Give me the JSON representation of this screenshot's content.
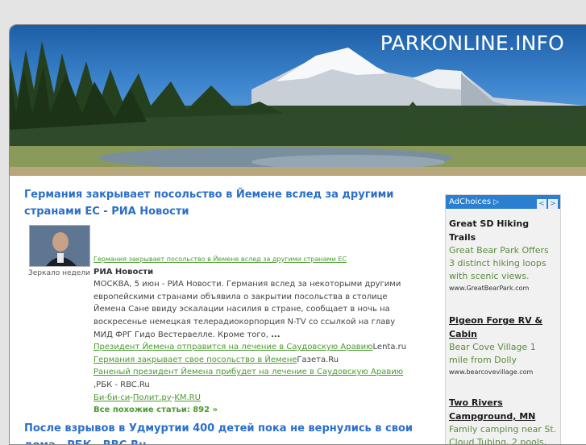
{
  "site": {
    "title": "PARKONLINE.INFO"
  },
  "articles": [
    {
      "title": "Германия закрывает посольство в Йемене вслед за другими странами ЕС - РИА Новости",
      "thumb_caption": "Зеркало недели",
      "headline_link": "Германия закрывает посольство в Йемене вслед за другими странами ЕС",
      "source": "РИА Новости",
      "body": "МОСКВА, 5 июн - РИА Новости. Германия вслед за некоторыми другими европейскими странами объявила о закрытии посольства в столице Йемена Сане ввиду эскалации насилия в стране, сообщает в ночь на воскресенье немецкая телерадиокорпорция N-TV со ссылкой на главу МИД ФРГ Гидо Вестервелле. Кроме того,",
      "ellipsis": "...",
      "related": [
        {
          "link": "Президент Йемена отправится на лечение в Саудовскую Аравию",
          "suffix": "Lenta.ru"
        },
        {
          "link": "Германия закрывает свое посольство в Йемене",
          "suffix": "Газета.Ru"
        },
        {
          "link": "Раненый президент Йемена прибудет на лечение в Саудовскую Аравию",
          "suffix": ",РБК - RBC.Ru"
        }
      ],
      "extra_sources": [
        "Би-би-си",
        "Полит.ру",
        "KM.RU"
      ],
      "extra_sep": "-",
      "all_news": "Все похожие статьи: 892 »"
    },
    {
      "title": "После взрывов в Удмуртии 400 детей пока не вернулись в свои дома - РБК - RBC.Ru"
    }
  ],
  "ads": {
    "choices_label": "AdChoices",
    "prev": "<",
    "next": ">",
    "items": [
      {
        "title": "Great SD Hiking Trails",
        "desc": "Great Bear Park Offers 3 distinct hiking loops with scenic views.",
        "url": "www.GreatBearPark.com"
      },
      {
        "title": "Pigeon Forge RV & Cabin",
        "desc": "Bear Cove Village 1 mile from Dolly",
        "url": "www.bearcovevillage.com"
      },
      {
        "title": "Two Rivers Campground, MN",
        "desc": "Family camping near St. Cloud Tubing, 2 pools,",
        "url": ""
      }
    ]
  },
  "colors": {
    "link_blue": "#2a6fc9",
    "link_green": "#4a9a2e",
    "ad_bar": "#2a7fd1"
  }
}
